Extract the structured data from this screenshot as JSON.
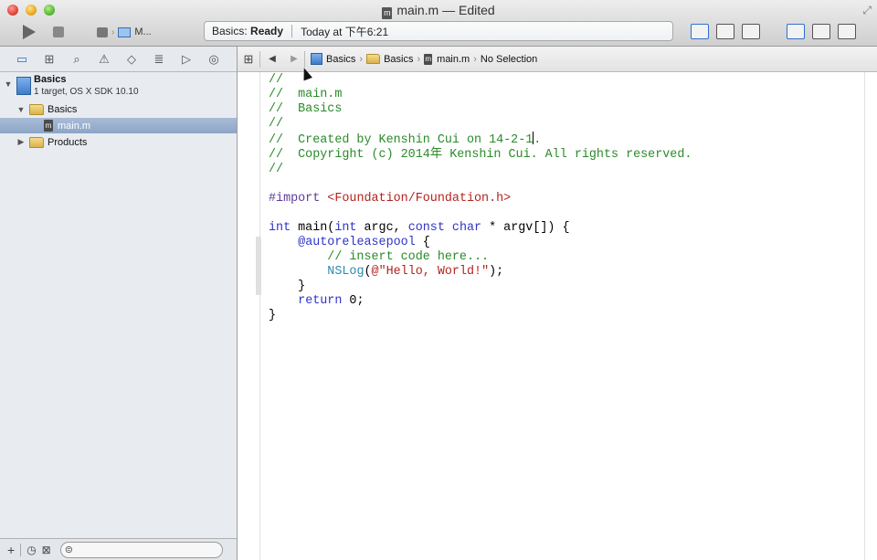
{
  "window": {
    "title": "main.m — Edited",
    "file_icon_letter": "m"
  },
  "toolbar": {
    "scheme_label": "M...",
    "activity_project": "Basics:",
    "activity_status": "Ready",
    "activity_time": "Today at 下午6:21"
  },
  "navigator": {
    "project_name": "Basics",
    "project_subtitle": "1 target, OS X SDK 10.10",
    "items": [
      {
        "label": "Basics",
        "kind": "folder"
      },
      {
        "label": "main.m",
        "kind": "file"
      },
      {
        "label": "Products",
        "kind": "folder"
      }
    ]
  },
  "jumpbar": {
    "crumbs": [
      "Basics",
      "Basics",
      "main.m",
      "No Selection"
    ]
  },
  "editor": {
    "lines": [
      "//",
      "//  main.m",
      "//  Basics",
      "//",
      "//  Created by Kenshin Cui on 14-2-1.",
      "//  Copyright (c) 2014年 Kenshin Cui. All rights reserved.",
      "//",
      "",
      "#import <Foundation/Foundation.h>",
      "",
      "int main(int argc, const char * argv[]) {",
      "    @autoreleasepool {",
      "        // insert code here...",
      "        NSLog(@\"Hello, World!\");",
      "    }",
      "    return 0;",
      "}"
    ]
  },
  "colors": {
    "comment": "#2a8a2a",
    "keyword": "#2f34c5",
    "string": "#b3241f",
    "selection": "#8ca5c7"
  }
}
